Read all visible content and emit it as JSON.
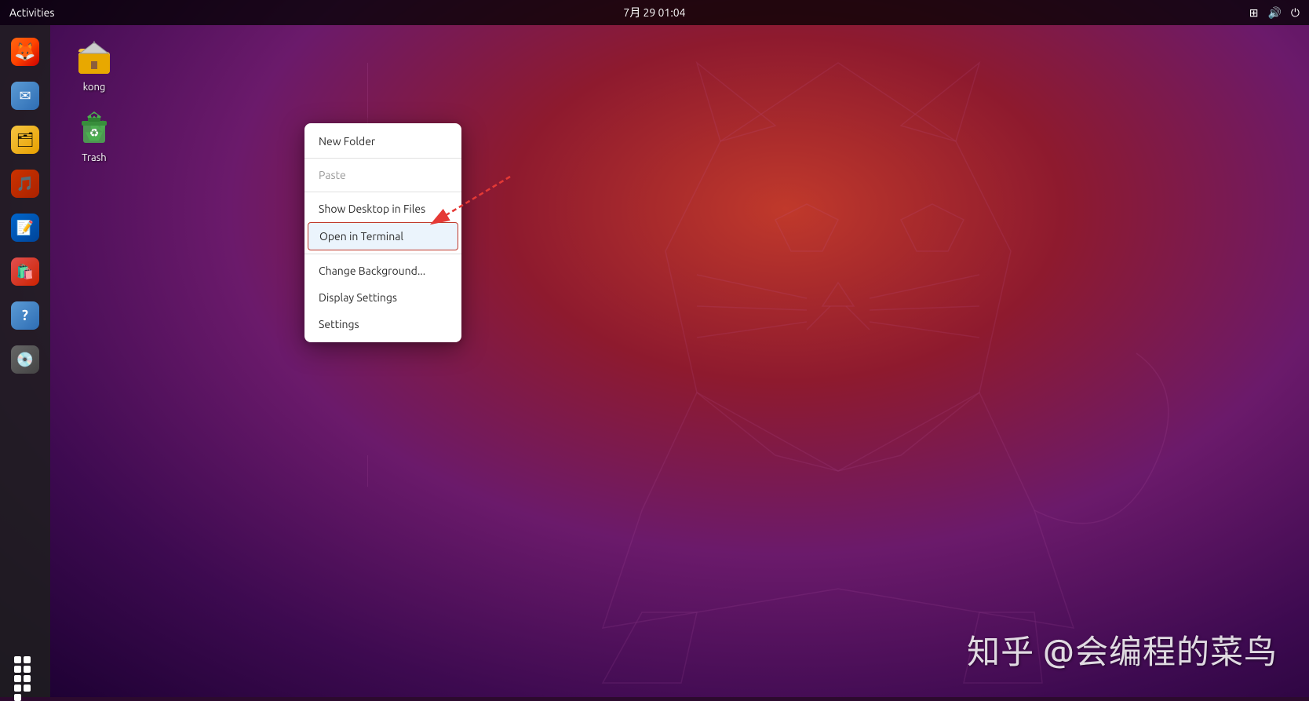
{
  "topbar": {
    "activities_label": "Activities",
    "datetime": "7月 29  01:04",
    "icons": [
      "network",
      "volume",
      "power"
    ]
  },
  "sidebar": {
    "items": [
      {
        "id": "firefox",
        "label": "Firefox",
        "emoji": "🦊"
      },
      {
        "id": "mail",
        "label": "Mail",
        "emoji": "✉️"
      },
      {
        "id": "files",
        "label": "Files",
        "emoji": "📁"
      },
      {
        "id": "sound",
        "label": "Rhythmbox",
        "emoji": "🎵"
      },
      {
        "id": "writer",
        "label": "Writer",
        "emoji": "📝"
      },
      {
        "id": "appstore",
        "label": "App Store",
        "emoji": "🛍️"
      },
      {
        "id": "help",
        "label": "Help",
        "emoji": "❓"
      },
      {
        "id": "dvd",
        "label": "DVD",
        "emoji": "💿"
      }
    ],
    "apps_grid_label": "Show Applications"
  },
  "desktop": {
    "icons": [
      {
        "id": "kong",
        "label": "kong",
        "type": "folder"
      },
      {
        "id": "trash",
        "label": "Trash",
        "type": "trash"
      }
    ]
  },
  "context_menu": {
    "items": [
      {
        "id": "new-folder",
        "label": "New Folder",
        "disabled": false,
        "highlighted": false,
        "separator_after": true
      },
      {
        "id": "paste",
        "label": "Paste",
        "disabled": true,
        "highlighted": false,
        "separator_after": true
      },
      {
        "id": "show-desktop",
        "label": "Show Desktop in Files",
        "disabled": false,
        "highlighted": false,
        "separator_after": false
      },
      {
        "id": "open-terminal",
        "label": "Open in Terminal",
        "disabled": false,
        "highlighted": true,
        "separator_after": true
      },
      {
        "id": "change-bg",
        "label": "Change Background...",
        "disabled": false,
        "highlighted": false,
        "separator_after": false
      },
      {
        "id": "display-settings",
        "label": "Display Settings",
        "disabled": false,
        "highlighted": false,
        "separator_after": false
      },
      {
        "id": "settings",
        "label": "Settings",
        "disabled": false,
        "highlighted": false,
        "separator_after": false
      }
    ]
  },
  "watermark": {
    "text": "知乎 @会编程的菜鸟"
  }
}
